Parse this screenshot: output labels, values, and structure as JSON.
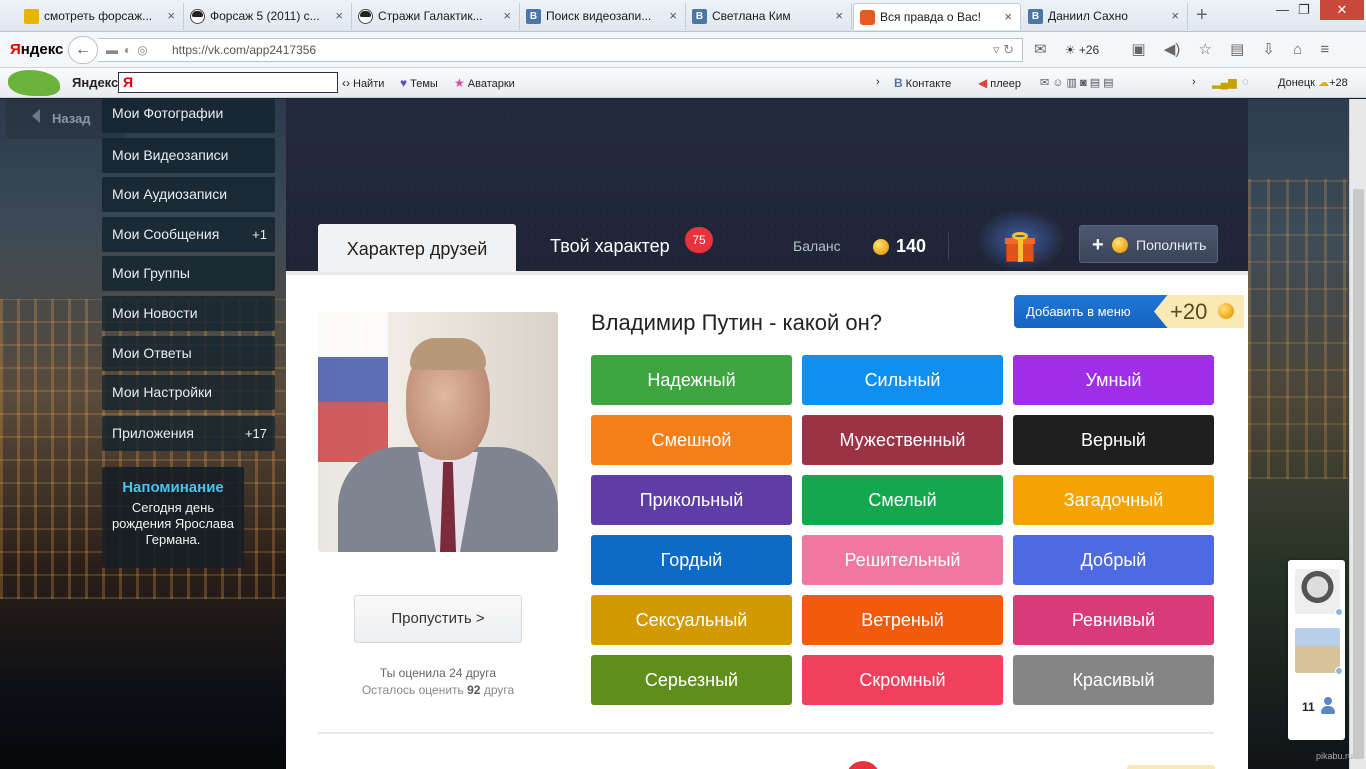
{
  "browser": {
    "tabs": [
      {
        "title": "смотреть форсаж...",
        "icon": "video-icon"
      },
      {
        "title": "Форсаж 5 (2011) с...",
        "icon": "troll-face-icon"
      },
      {
        "title": "Стражи Галактик...",
        "icon": "troll-face-icon"
      },
      {
        "title": "Поиск видеозапи...",
        "icon": "vk-icon"
      },
      {
        "title": "Светлана Ким",
        "icon": "vk-icon"
      },
      {
        "title": "Вся правда о Вас!",
        "icon": "app-sun-icon",
        "active": true
      },
      {
        "title": "Даниил Сахно",
        "icon": "vk-icon"
      }
    ],
    "new_tab": "+",
    "logo_red": "Я",
    "logo_black": "ндекс",
    "url": "https://vk.com/app2417356",
    "weather": "+26"
  },
  "yandex_bar": {
    "brand": "Яндекс",
    "search_value": "Я",
    "find": "Найти",
    "themes": "Темы",
    "avatars": "Аватарки",
    "vkontakte": "Контакте",
    "player": "плеер",
    "city": "Донецк",
    "temp": "+28"
  },
  "sidebar": {
    "back": "Назад",
    "items": [
      {
        "label": "Мои Фотографии",
        "count": ""
      },
      {
        "label": "Мои Видеозаписи",
        "count": ""
      },
      {
        "label": "Мои Аудиозаписи",
        "count": ""
      },
      {
        "label": "Мои Сообщения",
        "count": "+1"
      },
      {
        "label": "Мои Группы",
        "count": ""
      },
      {
        "label": "Мои Новости",
        "count": ""
      },
      {
        "label": "Мои Ответы",
        "count": ""
      },
      {
        "label": "Мои Настройки",
        "count": ""
      },
      {
        "label": "Приложения",
        "count": "+17"
      }
    ],
    "reminder_title": "Напоминание",
    "reminder_text": "Сегодня день рождения Ярослава Германа."
  },
  "app": {
    "tab_friends": "Характер друзей",
    "tab_you": "Твой характер",
    "tab_you_badge": "75",
    "balance_label": "Баланс",
    "balance_value": "140",
    "topup": "Пополнить",
    "question": "Владимир Путин - какой он?",
    "add_menu": "Добавить в меню",
    "add_menu_bonus": "+20",
    "traits": [
      {
        "label": "Надежный",
        "color": "#3ea541"
      },
      {
        "label": "Сильный",
        "color": "#0f8ff0"
      },
      {
        "label": "Умный",
        "color": "#a02ee6"
      },
      {
        "label": "Смешной",
        "color": "#f57f17"
      },
      {
        "label": "Мужественный",
        "color": "#9c3246"
      },
      {
        "label": "Верный",
        "color": "#1f1f1f"
      },
      {
        "label": "Прикольный",
        "color": "#5e3ea6"
      },
      {
        "label": "Смелый",
        "color": "#13a84e"
      },
      {
        "label": "Загадочный",
        "color": "#f5a300"
      },
      {
        "label": "Гордый",
        "color": "#0c6bc7"
      },
      {
        "label": "Решительный",
        "color": "#ef77a0"
      },
      {
        "label": "Добрый",
        "color": "#4d6ae0"
      },
      {
        "label": "Сексуальный",
        "color": "#d39a00"
      },
      {
        "label": "Ветреный",
        "color": "#f25a0e"
      },
      {
        "label": "Ревнивый",
        "color": "#d93a7a"
      },
      {
        "label": "Серьезный",
        "color": "#5f8e1d"
      },
      {
        "label": "Скромный",
        "color": "#f0405e"
      },
      {
        "label": "Красивый",
        "color": "#858585"
      }
    ],
    "skip": "Пропустить >",
    "rated_text": "Ты оценила 24 друга",
    "remain_prefix": "Осталось оценить",
    "remain_count": "92",
    "remain_suffix": "друга"
  },
  "friends_panel": {
    "count": "11"
  },
  "watermark": "pikabu.ru"
}
